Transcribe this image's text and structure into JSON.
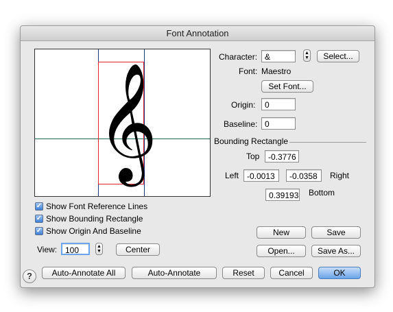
{
  "window": {
    "title": "Font Annotation"
  },
  "preview": {
    "glyph": "𝄞"
  },
  "character": {
    "label": "Character:",
    "value": "&",
    "select_label": "Select..."
  },
  "font": {
    "label": "Font:",
    "value": "Maestro",
    "set_font_label": "Set Font..."
  },
  "origin": {
    "label": "Origin:",
    "value": "0"
  },
  "baseline": {
    "label": "Baseline:",
    "value": "0"
  },
  "bounding": {
    "title": "Bounding Rectangle",
    "top_label": "Top",
    "top_value": "-0.3776",
    "left_label": "Left",
    "left_value": "-0.0013",
    "right_value": "-0.0358",
    "right_label": "Right",
    "bottom_value": "0.39193",
    "bottom_label": "Bottom"
  },
  "checkboxes": [
    {
      "label": "Show Font Reference Lines",
      "checked": true
    },
    {
      "label": "Show Bounding Rectangle",
      "checked": true
    },
    {
      "label": "Show Origin And Baseline",
      "checked": true
    }
  ],
  "view": {
    "label": "View:",
    "value": "100",
    "center_label": "Center"
  },
  "buttons": {
    "new": "New",
    "save": "Save",
    "open": "Open...",
    "save_as": "Save As...",
    "auto_annotate_all": "Auto-Annotate All",
    "auto_annotate": "Auto-Annotate",
    "reset": "Reset",
    "cancel": "Cancel",
    "ok": "OK",
    "help": "?"
  },
  "colors": {
    "bbox": "#e0262a",
    "reference_vertical": "#1d3a7a",
    "reference_horizontal": "#1f6b5b",
    "default_button": "#6aa4ea"
  }
}
